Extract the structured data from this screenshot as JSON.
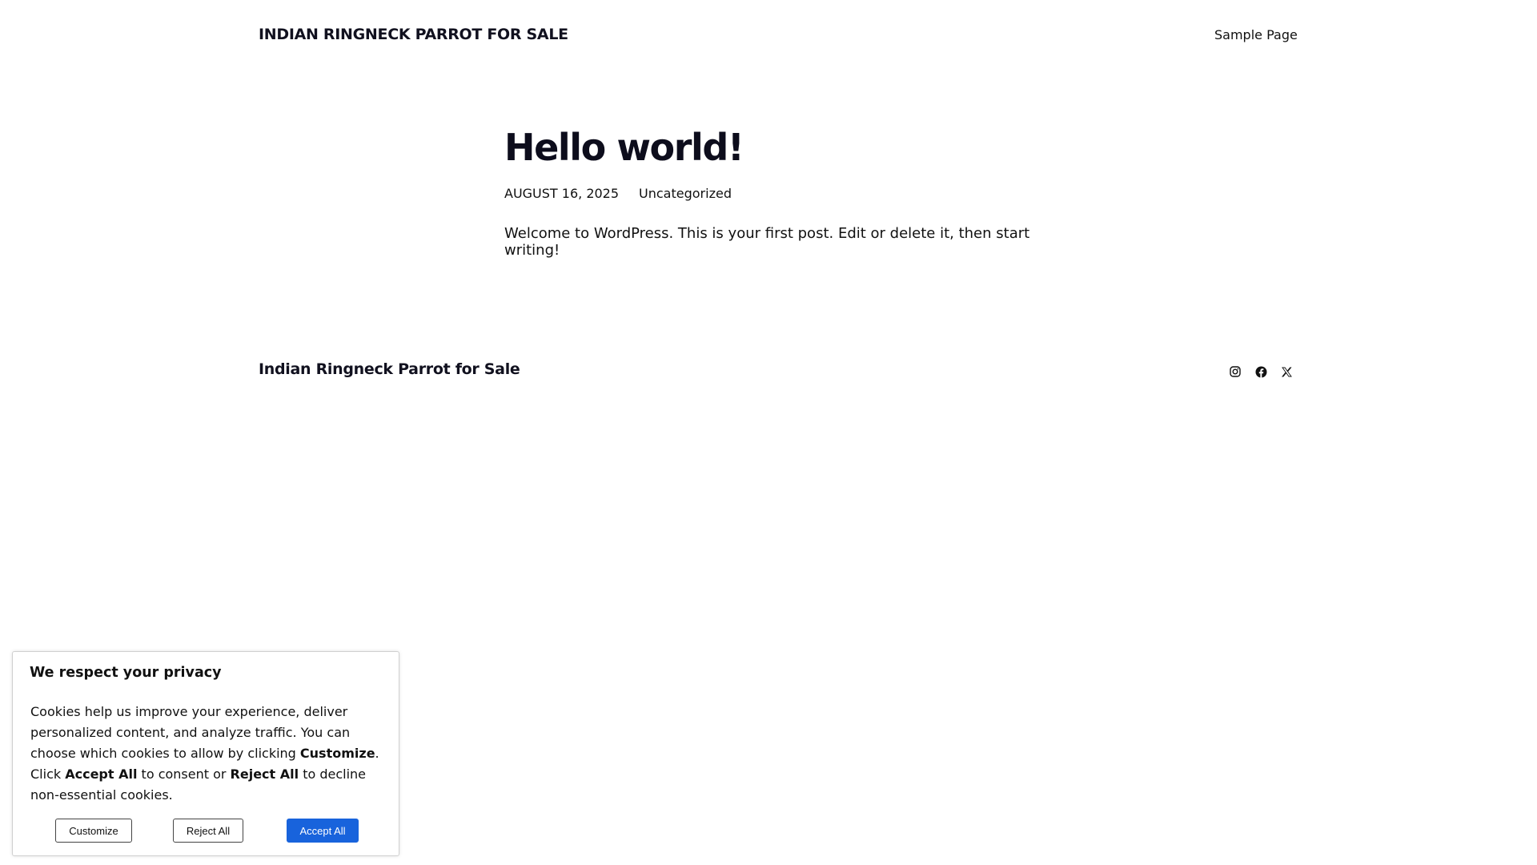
{
  "header": {
    "site_title": "INDIAN RINGNECK PARROT FOR SALE",
    "nav": [
      "Sample Page"
    ]
  },
  "post": {
    "title": "Hello world!",
    "date": "AUGUST 16, 2025",
    "category": "Uncategorized",
    "content": "Welcome to WordPress. This is your first post. Edit or delete it, then start writing!"
  },
  "footer": {
    "site_title": "Indian Ringneck Parrot for Sale",
    "social_icons": [
      "instagram-icon",
      "facebook-icon",
      "x-icon"
    ]
  },
  "cookie_banner": {
    "title": "We respect your privacy",
    "text_part1": "Cookies help us improve your experience, deliver personalized content, and analyze traffic. You can choose which cookies to allow by clicking ",
    "text_customize": "Customize",
    "text_part2": ". Click ",
    "text_accept": "Accept All",
    "text_part3": " to consent or ",
    "text_reject": "Reject All",
    "text_part4": " to decline non-essential cookies.",
    "customize_label": "Customize",
    "reject_label": "Reject All",
    "accept_label": "Accept All",
    "accent_color": "#1863dc"
  }
}
